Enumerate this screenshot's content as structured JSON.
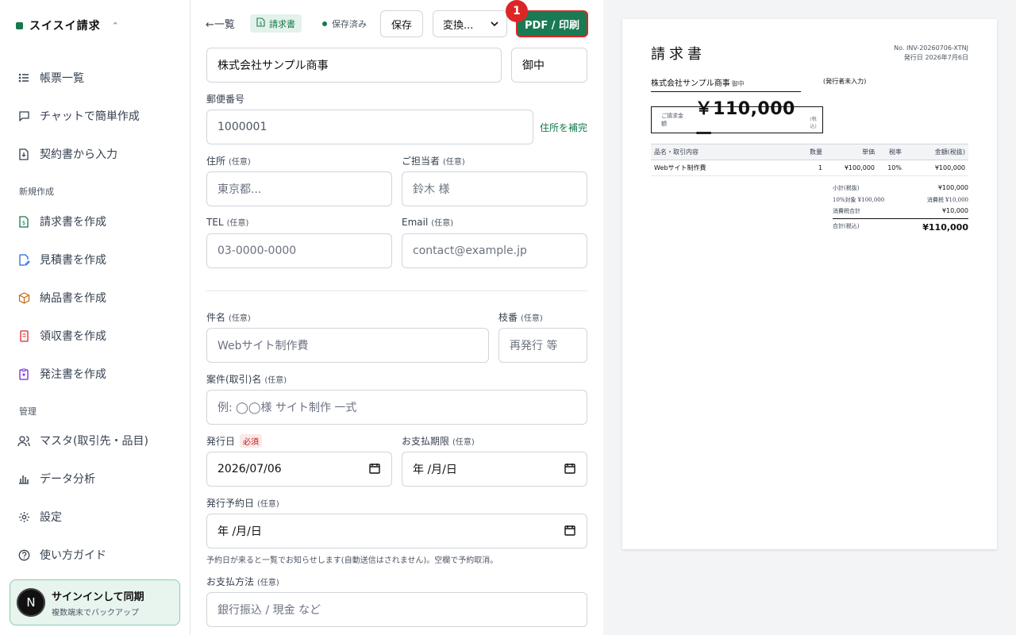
{
  "sidebar": {
    "brand": "スイスイ請求",
    "nav_top": [
      {
        "label": "帳票一覧"
      },
      {
        "label": "チャットで簡単作成"
      },
      {
        "label": "契約書から入力"
      }
    ],
    "section_create": "新規作成",
    "nav_create": [
      {
        "label": "請求書を作成"
      },
      {
        "label": "見積書を作成"
      },
      {
        "label": "納品書を作成"
      },
      {
        "label": "領収書を作成"
      },
      {
        "label": "発注書を作成"
      }
    ],
    "section_manage": "管理",
    "nav_manage": [
      {
        "label": "マスタ(取引先・品目)"
      },
      {
        "label": "データ分析"
      },
      {
        "label": "設定"
      },
      {
        "label": "使い方ガイド"
      }
    ],
    "signin": {
      "avatar": "N",
      "title": "サインインして同期",
      "subtitle": "複数端末でバックアップ"
    }
  },
  "toolbar": {
    "back": "←一覧",
    "doc_type": "請求書",
    "saved": "保存済み",
    "save": "保存",
    "convert": "変換...",
    "pdf": "PDF / 印刷",
    "marker": "1"
  },
  "form": {
    "client_name": "株式会社サンプル商事",
    "honorific": "御中",
    "postal_label": "郵便番号",
    "postal_value": "1000001",
    "address_fill": "住所を補完",
    "address_label": "住所",
    "address_placeholder": "東京都...",
    "contact_label": "ご担当者",
    "contact_placeholder": "鈴木 様",
    "tel_label": "TEL",
    "tel_placeholder": "03-0000-0000",
    "email_label": "Email",
    "email_placeholder": "contact@example.jp",
    "optional": "(任意)",
    "required": "必須",
    "subject_label": "件名",
    "subject_placeholder": "Webサイト制作費",
    "branch_label": "枝番",
    "branch_placeholder": "再発行 等",
    "deal_label": "案件(取引)名",
    "deal_placeholder": "例: ◯◯様 サイト制作 一式",
    "issue_label": "発行日",
    "issue_value": "2026/07/06",
    "due_label": "お支払期限",
    "due_value": "年 /月/日",
    "schedule_label": "発行予約日",
    "schedule_value": "年 /月/日",
    "schedule_hint": "予約日が来ると一覧でお知らせします(自動送信はされません)。空欄で予約取消。",
    "payment_label": "お支払方法",
    "payment_placeholder": "銀行振込 / 現金 など"
  },
  "preview": {
    "title": "請求書",
    "number": "No. INV-20260706-XTNJ",
    "issue_date": "発行日 2026年7月6日",
    "client": "株式会社サンプル商事",
    "honorific": "御中",
    "issuer": "(発行者未入力)",
    "total_label": "ご請求金額",
    "total": "￥110,000ー",
    "total_tax_note": "(税込)",
    "headers": [
      "品名・取引内容",
      "数量",
      "単価",
      "税率",
      "金額(税抜)"
    ],
    "rows": [
      [
        "Webサイト制作費",
        "1",
        "¥100,000",
        "10%",
        "¥100,000"
      ]
    ],
    "subtotal_label": "小計(税抜)",
    "subtotal": "¥100,000",
    "tax_base_label": "10%対象 ¥100,000",
    "tax_label": "消費税 ¥10,000",
    "tax_total_label": "消費税合計",
    "tax_total": "¥10,000",
    "grand_label": "合計(税込)",
    "grand_total": "¥110,000"
  },
  "colors": {
    "accent": "#1a7a53",
    "marker": "#dc2626"
  }
}
